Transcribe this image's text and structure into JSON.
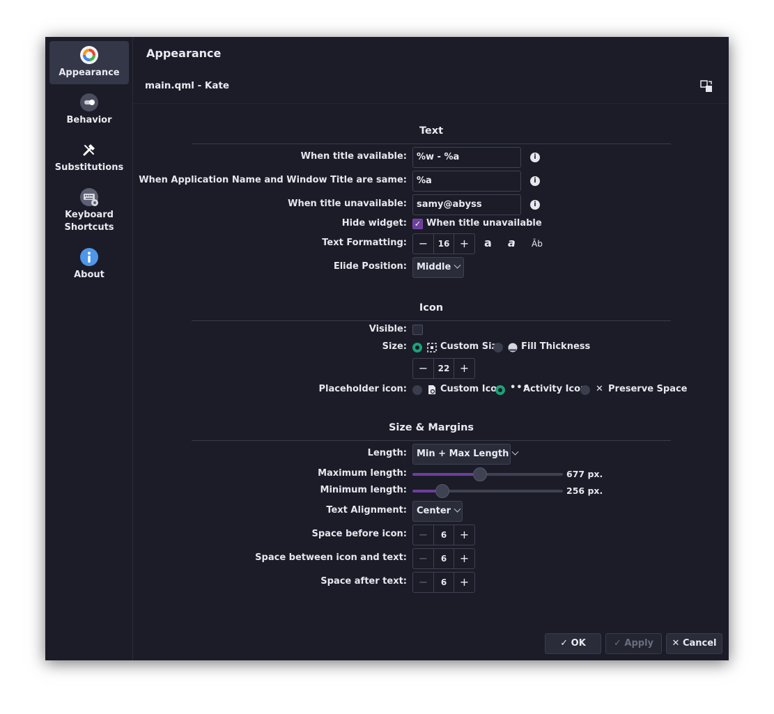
{
  "sidebar": {
    "items": [
      {
        "label": "Appearance",
        "icon": "color-wheel-icon",
        "active": true
      },
      {
        "label": "Behavior",
        "icon": "toggle-icon"
      },
      {
        "label": "Substitutions",
        "icon": "tools-icon"
      },
      {
        "label": "Keyboard Shortcuts",
        "icon": "keyboard-icon"
      },
      {
        "label": "About",
        "icon": "info-icon"
      }
    ]
  },
  "header": {
    "title": "Appearance",
    "subtitle": "main.qml - Kate"
  },
  "text_section": {
    "title": "Text",
    "title_available_label": "When title available:",
    "title_available_value": "%w - %a",
    "same_label": "When Application Name and Window Title are same:",
    "same_value": "%a",
    "unavailable_label": "When title unavailable:",
    "unavailable_value": "samy@abyss",
    "hide_widget_label": "Hide widget:",
    "hide_widget_option": "When title unavailable",
    "formatting_label": "Text Formatting:",
    "font_size": "16",
    "bold_glyph": "a",
    "italic_glyph": "a",
    "case_glyph": "Âb",
    "elide_label": "Elide Position:",
    "elide_value": "Middle"
  },
  "icon_section": {
    "title": "Icon",
    "visible_label": "Visible:",
    "size_label": "Size:",
    "custom_size": "Custom Size",
    "fill_thickness": "Fill Thickness",
    "size_value": "22",
    "placeholder_label": "Placeholder icon:",
    "custom_icon": "Custom Icon",
    "activity_icon": "Activity Icon",
    "preserve_space": "Preserve Space"
  },
  "margins_section": {
    "title": "Size & Margins",
    "length_label": "Length:",
    "length_value": "Min + Max Length",
    "max_length_label": "Maximum length:",
    "max_length_value": "677 px.",
    "max_length_fraction": 0.45,
    "min_length_label": "Minimum length:",
    "min_length_value": "256 px.",
    "min_length_fraction": 0.2,
    "alignment_label": "Text Alignment:",
    "alignment_value": "Center",
    "space_before_label": "Space before icon:",
    "space_before_value": "6",
    "space_between_label": "Space between icon and text:",
    "space_between_value": "6",
    "space_after_label": "Space after text:",
    "space_after_value": "6"
  },
  "buttons": {
    "ok": "OK",
    "apply": "Apply",
    "cancel": "Cancel"
  },
  "colors": {
    "background": "#1b1c27",
    "accent_purple": "#6d3f9c",
    "accent_green": "#1aa37a"
  }
}
